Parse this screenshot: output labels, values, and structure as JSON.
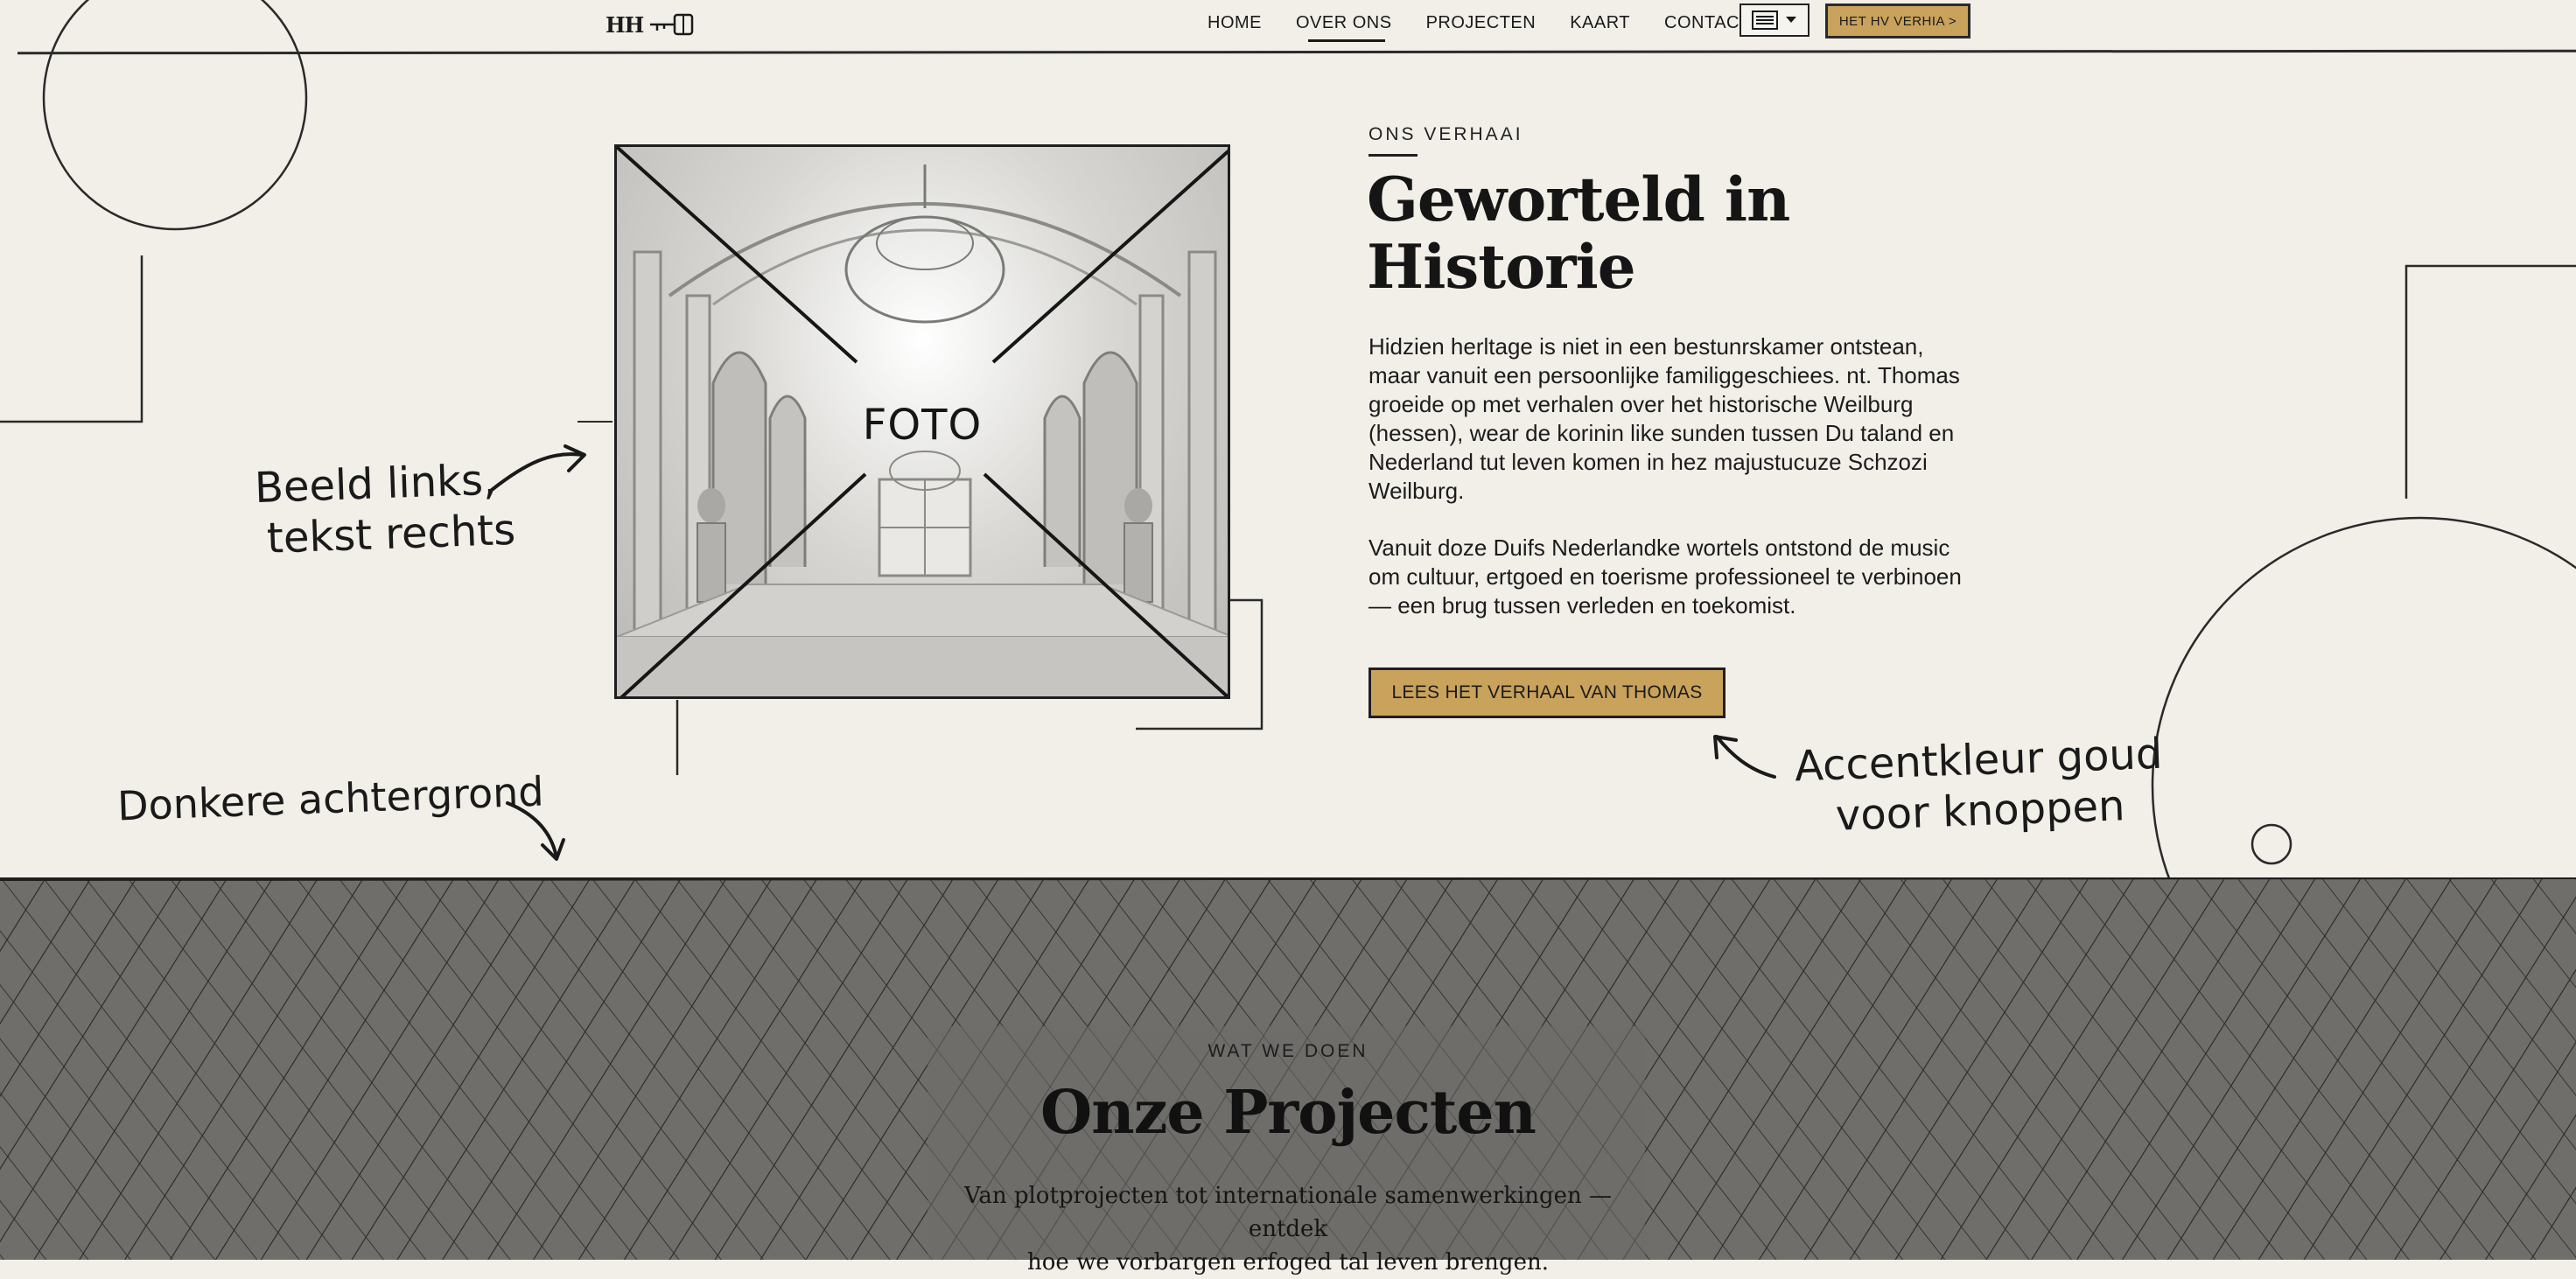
{
  "nav": {
    "logo": "HH",
    "links": [
      "HOME",
      "OVER ONS",
      "PROJECTEN",
      "KAART",
      "CONTACT"
    ],
    "active": "OVER ONS",
    "lang_icon": "flag-menu-icon",
    "cta": "HET HV VERHIA >"
  },
  "photo": {
    "label": "FOTO"
  },
  "about": {
    "eyebrow": "ONS VERHAAI",
    "title": "Geworteld in Historie",
    "paragraph1": "Hidzien herltage is niet in een bestunrskamer ontstean, maar vanuit een persoonlijke familiggeschiees. nt. Thomas groeide op met verhalen over het historische Weilburg (hessen), wear de korinin like sunden tussen Du taland en Nederland tut leven komen in hez majustucuze Schzozi Weilburg.",
    "paragraph2": "Vanuit doze Duifs Nederlandke wortels ontstond de music om cultuur, ertgoed en toerisme professioneel te verbinoen — een brug tussen verleden en toekomist.",
    "cta": "LEES HET VERHAAL VAN THOMAS"
  },
  "notes": {
    "left_line1": "Beeld links,",
    "left_line2": "tekst rechts",
    "bottom_left": "Donkere achtergrond",
    "right_line1": "Accentkleur goud",
    "right_line2": "voor knoppen"
  },
  "projects": {
    "eyebrow": "WAT WE DOEN",
    "title": "Onze Projecten",
    "subtitle_line1": "Van plotprojecten tot internationale samenwerkingen — entdek",
    "subtitle_line2": "hoe we vorbargen erfoged tal leven brengen."
  },
  "colors": {
    "accent": "#c9a25b",
    "background": "#f1efe8",
    "dark_section": "#6f6e6a",
    "ink": "#1c1c1c"
  }
}
